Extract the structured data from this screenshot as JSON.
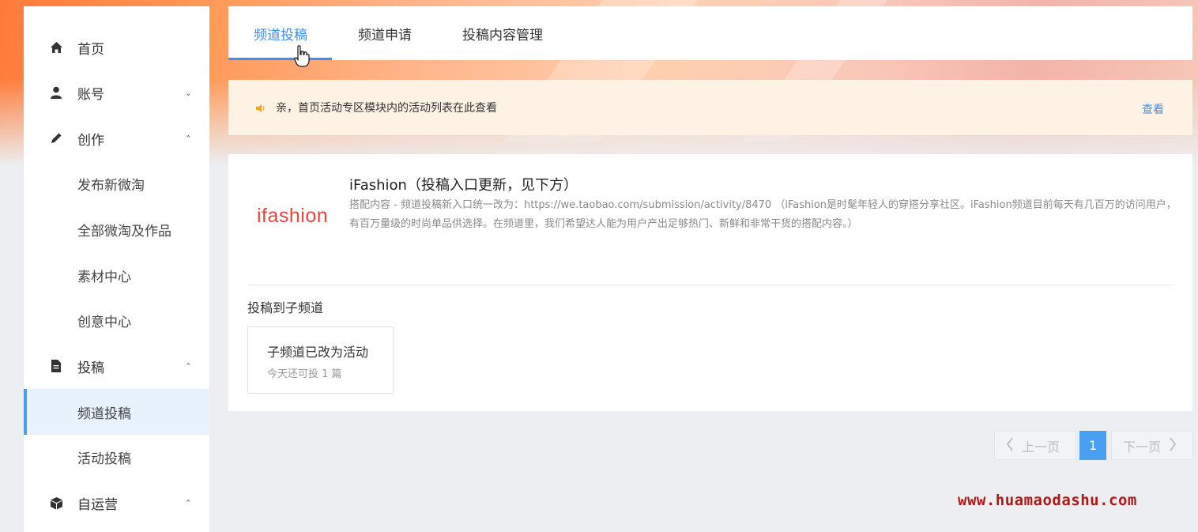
{
  "sidebar": {
    "items": [
      {
        "label": "首页",
        "icon": "home-icon"
      },
      {
        "label": "账号",
        "icon": "user-icon",
        "chevron": "⌄"
      },
      {
        "label": "创作",
        "icon": "pencil-icon",
        "chevron": "⌃"
      },
      {
        "label": "发布新微淘"
      },
      {
        "label": "全部微淘及作品"
      },
      {
        "label": "素材中心"
      },
      {
        "label": "创意中心"
      },
      {
        "label": "投稿",
        "icon": "document-icon",
        "chevron": "⌃"
      },
      {
        "label": "频道投稿",
        "active": true
      },
      {
        "label": "活动投稿"
      },
      {
        "label": "自运营",
        "icon": "box-icon",
        "chevron": "⌃"
      }
    ]
  },
  "tabs": [
    {
      "label": "频道投稿",
      "active": true
    },
    {
      "label": "频道申请"
    },
    {
      "label": "投稿内容管理"
    }
  ],
  "notice": {
    "text": "亲，首页活动专区模块内的活动列表在此查看",
    "link": "查看"
  },
  "channel": {
    "logo_text": "ifashion",
    "title": "iFashion（投稿入口更新，见下方）",
    "description": "搭配内容 - 频道投稿新入口统一改为：https://we.taobao.com/submission/activity/8470 （iFashion是时髦年轻人的穿搭分享社区。iFashion频道目前每天有几百万的访问用户，有百万量级的时尚单品供选择。在频道里，我们希望达人能为用户产出足够热门、新鲜和非常干货的搭配内容。）"
  },
  "subchannel": {
    "section_title": "投稿到子频道",
    "card_name": "子频道已改为活动",
    "card_quota": "今天还可投 1 篇"
  },
  "pagination": {
    "prev": "上一页",
    "current": "1",
    "next": "下一页"
  },
  "watermark": "www.huamaodashu.com",
  "colors": {
    "accent": "#3d8ff0",
    "logo": "#e8463b",
    "notice_bg": "#fdf2e4",
    "watermark": "#b01818"
  }
}
